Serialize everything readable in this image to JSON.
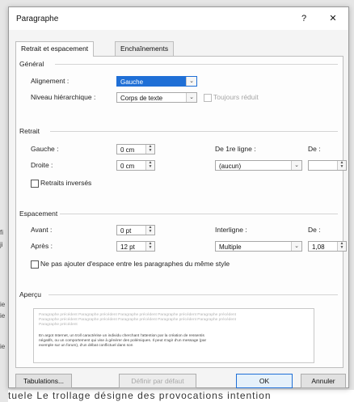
{
  "dialog": {
    "title": "Paragraphe",
    "help_label": "?",
    "close_label": "✕"
  },
  "tabs": [
    "Retrait et espacement",
    "Enchaînements"
  ],
  "general": {
    "section": "Général",
    "alignment_label": "Alignement :",
    "alignment_value": "Gauche",
    "level_label": "Niveau hiérarchique :",
    "level_value": "Corps de texte",
    "collapsed_label": "Toujours réduit"
  },
  "indent": {
    "section": "Retrait",
    "left_label": "Gauche :",
    "left_value": "0 cm",
    "right_label": "Droite :",
    "right_value": "0 cm",
    "first_line_label": "De 1re ligne :",
    "first_line_value": "(aucun)",
    "by_label": "De :",
    "by_value": "",
    "mirror_label": "Retraits inversés"
  },
  "spacing": {
    "section": "Espacement",
    "before_label": "Avant :",
    "before_value": "0 pt",
    "after_label": "Après :",
    "after_value": "12 pt",
    "line_label": "Interligne :",
    "line_value": "Multiple",
    "at_label": "De :",
    "at_value": "1,08",
    "no_space_label": "Ne pas ajouter d'espace entre les paragraphes du même style"
  },
  "preview": {
    "section": "Aperçu",
    "prev_line1": "Paragraphe précédent Paragraphe précédent Paragraphe précédent Paragraphe précédent Paragraphe précédent",
    "prev_line2": "Paragraphe précédent Paragraphe précédent Paragraphe précédent Paragraphe précédent Paragraphe précédent",
    "prev_line3": "Paragraphe précédent",
    "body_line1": "En argot Internet, un troll caractérise un individu cherchant l'attention par la création de ressentis",
    "body_line2": "négatifs, ou un comportement qui vise à générer des polémiques. Il peut s'agir d'un message (par",
    "body_line3": "exemple sur un forum), d'un débat conflictuel dans son"
  },
  "buttons": {
    "tabs": "Tabulations...",
    "default": "Définir par défaut",
    "ok": "OK",
    "cancel": "Annuler"
  },
  "background": {
    "bottom_text": "tuele Le trollage désigne des provocations intention",
    "left_marks": [
      "fi",
      "ji",
      "ie",
      "ie",
      "ie"
    ]
  }
}
